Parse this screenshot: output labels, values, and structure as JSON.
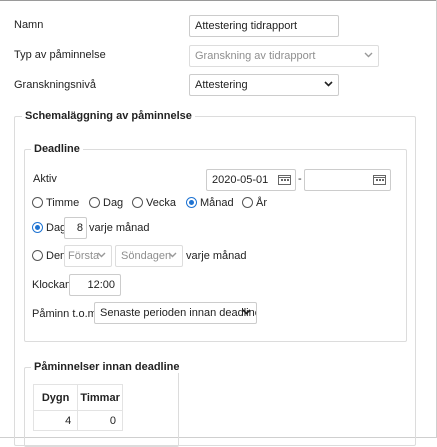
{
  "form": {
    "name_label": "Namn",
    "name_value": "Attestering tidrapport",
    "type_label": "Typ av påminnelse",
    "type_value": "Granskning av tidrapport",
    "level_label": "Granskningsnivå",
    "level_value": "Attestering"
  },
  "schedule": {
    "legend": "Schemaläggning av påminnelse",
    "deadline": {
      "legend": "Deadline",
      "active_label": "Aktiv",
      "date_from": "2020-05-01",
      "date_separator": "-",
      "date_to": "",
      "period_options": [
        {
          "label": "Timme",
          "checked": false
        },
        {
          "label": "Dag",
          "checked": false
        },
        {
          "label": "Vecka",
          "checked": false
        },
        {
          "label": "Månad",
          "checked": true
        },
        {
          "label": "År",
          "checked": false
        }
      ],
      "day_option_label": "Dag",
      "day_value": "8",
      "day_suffix": "varje månad",
      "the_option_label": "Den",
      "the_ordinal": "Första",
      "the_weekday": "Söndagen",
      "the_suffix": "varje månad",
      "clock_label": "Klockan",
      "clock_value": "12:00",
      "remind_label": "Påminn t.o.m.",
      "remind_value": "Senaste perioden innan deadline"
    },
    "reminders": {
      "legend": "Påminnelser innan deadline",
      "columns": [
        "Dygn",
        "Timmar"
      ],
      "rows": [
        [
          "4",
          "0"
        ]
      ]
    }
  },
  "colors": {
    "accent": "#1e73d2",
    "border": "#cccccc"
  }
}
